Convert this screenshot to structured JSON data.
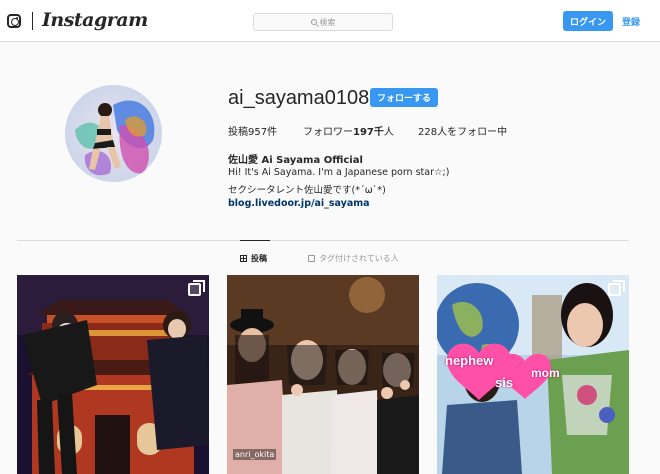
{
  "topbar": {
    "brand": "Instagram",
    "search_placeholder": "検索",
    "login_label": "ログイン",
    "signup_label": "登録"
  },
  "profile": {
    "username": "ai_sayama0108",
    "follow_label": "フォローする",
    "stats": {
      "posts": "投稿957件",
      "followers_prefix": "フォロワー",
      "followers_count": "197千",
      "followers_suffix": "人",
      "following": "228人をフォロー中"
    },
    "bio_name": "佐山愛 Ai Sayama Official",
    "bio_lines": [
      "Hi! It's Ai Sayama.  I'm a Japanese porn star☆;)",
      "セクシータレント佐山愛です(*´ω`*)"
    ],
    "bio_link": "blog.livedoor.jp/ai_sayama"
  },
  "tabs": {
    "posts_label": "投稿",
    "tagged_label": "タグ付けされている人"
  },
  "posts": [
    {
      "type": "multi"
    },
    {
      "type": "single",
      "caption": "anri_okita"
    },
    {
      "type": "multi",
      "stickers": [
        "nephew",
        "sis",
        "mom"
      ]
    }
  ],
  "colors": {
    "accent": "#3897f0",
    "link": "#003569",
    "border": "#dbdbdb",
    "background": "#fafafa"
  }
}
